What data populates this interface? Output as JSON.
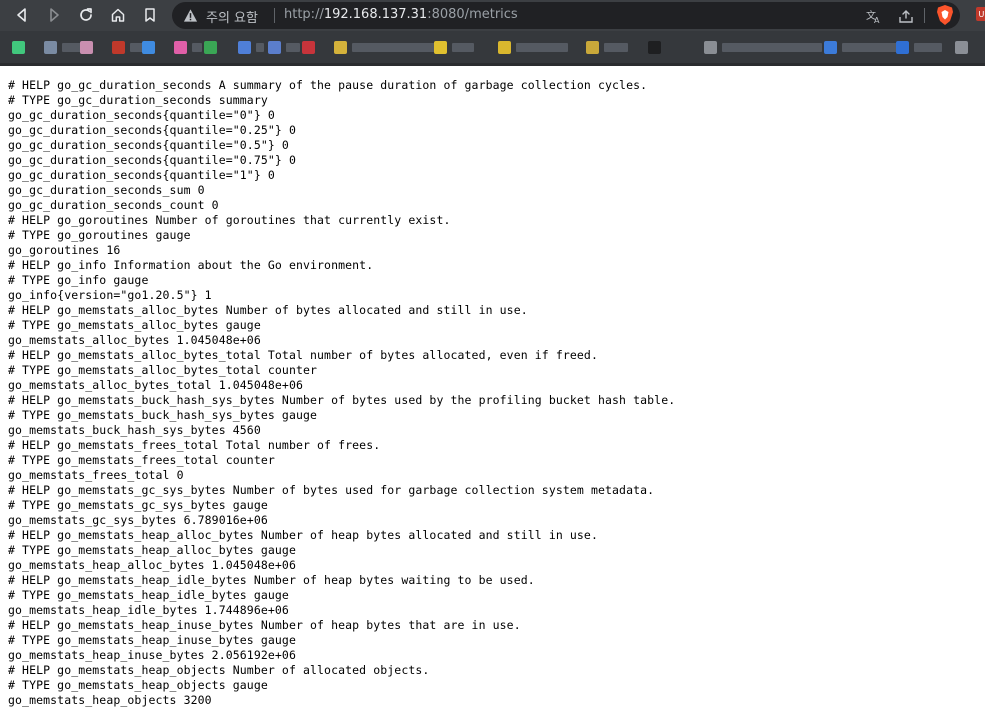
{
  "browser": {
    "security_label": "주의 요함",
    "url": {
      "scheme": "http://",
      "host": "192.168.137.31",
      "rest": ":8080/metrics"
    },
    "colors": {
      "toolbar": "#3c3f43",
      "address_bar": "#202124",
      "bookmarks_bar": "#35383c",
      "brave_accent": "#fb542b"
    },
    "icons": [
      "back-icon",
      "forward-icon",
      "reload-icon",
      "home-icon",
      "bookmark-icon",
      "warning-icon",
      "translate-icon",
      "share-icon",
      "brave-shields-icon",
      "extension-icon"
    ]
  },
  "bookmarks": {
    "items": [
      {
        "icon_color": "#41c77d"
      },
      {
        "icon_color": "#7a8ba3"
      },
      {
        "icon_color": "#c98fb0"
      },
      {
        "icon_color": "#c0392b"
      },
      {
        "icon_color": "#3f8be0"
      },
      {
        "icon_color": "#e05fa8"
      },
      {
        "icon_color": "#3aa655"
      },
      {
        "icon_color": "#4f7fd8"
      },
      {
        "icon_color": "#5b7ecc"
      },
      {
        "icon_color": "#c7343b"
      },
      {
        "icon_color": "#d4b23b"
      },
      {
        "icon_color": "#e0c02f"
      },
      {
        "icon_color": "#d9b72e"
      },
      {
        "icon_color": "#c9a83a"
      },
      {
        "icon_color": "#1e1f21"
      },
      {
        "icon_color": "#8a8e94"
      },
      {
        "icon_color": "#3c7bd9"
      },
      {
        "icon_color": "#2f6fd4"
      },
      {
        "icon_color": "#8b8f96"
      }
    ]
  },
  "page": {
    "lines": [
      "# HELP go_gc_duration_seconds A summary of the pause duration of garbage collection cycles.",
      "# TYPE go_gc_duration_seconds summary",
      "go_gc_duration_seconds{quantile=\"0\"} 0",
      "go_gc_duration_seconds{quantile=\"0.25\"} 0",
      "go_gc_duration_seconds{quantile=\"0.5\"} 0",
      "go_gc_duration_seconds{quantile=\"0.75\"} 0",
      "go_gc_duration_seconds{quantile=\"1\"} 0",
      "go_gc_duration_seconds_sum 0",
      "go_gc_duration_seconds_count 0",
      "# HELP go_goroutines Number of goroutines that currently exist.",
      "# TYPE go_goroutines gauge",
      "go_goroutines 16",
      "# HELP go_info Information about the Go environment.",
      "# TYPE go_info gauge",
      "go_info{version=\"go1.20.5\"} 1",
      "# HELP go_memstats_alloc_bytes Number of bytes allocated and still in use.",
      "# TYPE go_memstats_alloc_bytes gauge",
      "go_memstats_alloc_bytes 1.045048e+06",
      "# HELP go_memstats_alloc_bytes_total Total number of bytes allocated, even if freed.",
      "# TYPE go_memstats_alloc_bytes_total counter",
      "go_memstats_alloc_bytes_total 1.045048e+06",
      "# HELP go_memstats_buck_hash_sys_bytes Number of bytes used by the profiling bucket hash table.",
      "# TYPE go_memstats_buck_hash_sys_bytes gauge",
      "go_memstats_buck_hash_sys_bytes 4560",
      "# HELP go_memstats_frees_total Total number of frees.",
      "# TYPE go_memstats_frees_total counter",
      "go_memstats_frees_total 0",
      "# HELP go_memstats_gc_sys_bytes Number of bytes used for garbage collection system metadata.",
      "# TYPE go_memstats_gc_sys_bytes gauge",
      "go_memstats_gc_sys_bytes 6.789016e+06",
      "# HELP go_memstats_heap_alloc_bytes Number of heap bytes allocated and still in use.",
      "# TYPE go_memstats_heap_alloc_bytes gauge",
      "go_memstats_heap_alloc_bytes 1.045048e+06",
      "# HELP go_memstats_heap_idle_bytes Number of heap bytes waiting to be used.",
      "# TYPE go_memstats_heap_idle_bytes gauge",
      "go_memstats_heap_idle_bytes 1.744896e+06",
      "# HELP go_memstats_heap_inuse_bytes Number of heap bytes that are in use.",
      "# TYPE go_memstats_heap_inuse_bytes gauge",
      "go_memstats_heap_inuse_bytes 2.056192e+06",
      "# HELP go_memstats_heap_objects Number of allocated objects.",
      "# TYPE go_memstats_heap_objects gauge",
      "go_memstats_heap_objects 3200"
    ]
  }
}
